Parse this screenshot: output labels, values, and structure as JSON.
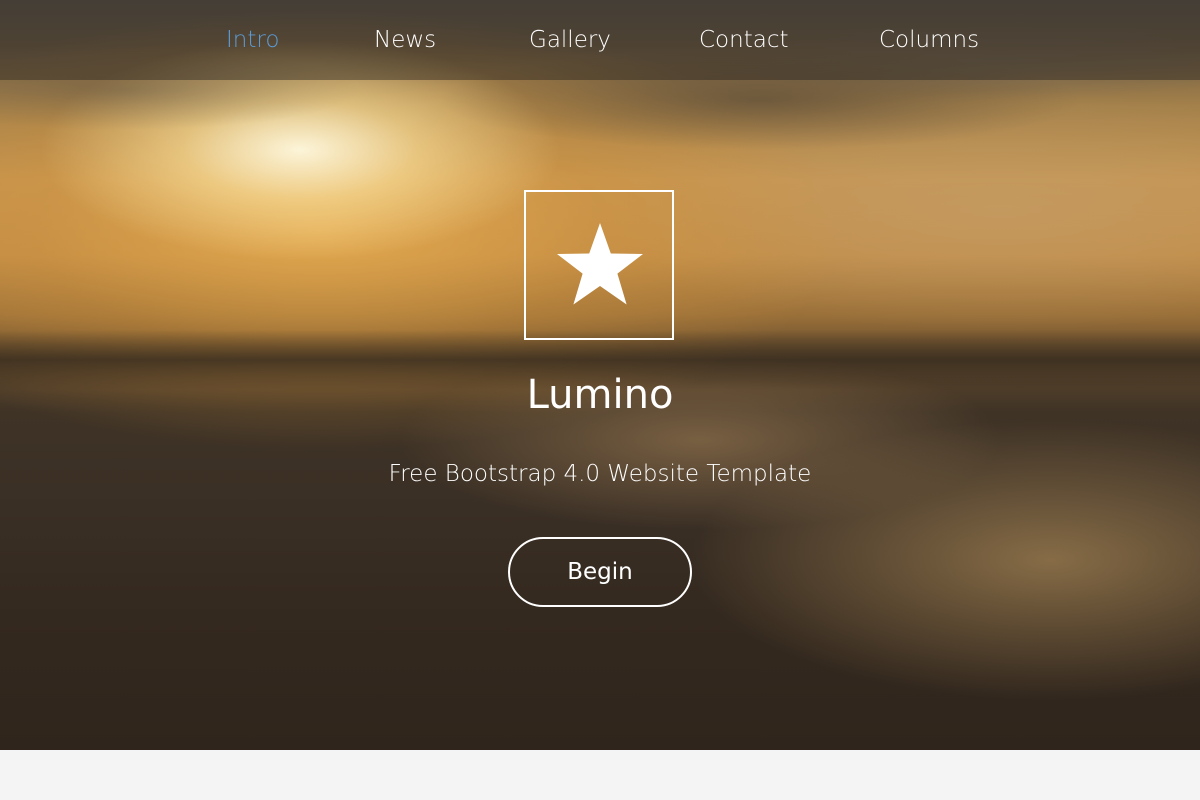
{
  "nav": {
    "items": [
      {
        "label": "Intro",
        "active": true
      },
      {
        "label": "News",
        "active": false
      },
      {
        "label": "Gallery",
        "active": false
      },
      {
        "label": "Contact",
        "active": false
      },
      {
        "label": "Columns",
        "active": false
      }
    ],
    "active_color": "#5b9bd5"
  },
  "hero": {
    "icon": "star-icon",
    "title": "Lumino",
    "subtitle": "Free Bootstrap 4.0 Website Template",
    "button_label": "Begin"
  },
  "colors": {
    "text": "#ffffff",
    "footer_background": "#f4f4f4"
  }
}
